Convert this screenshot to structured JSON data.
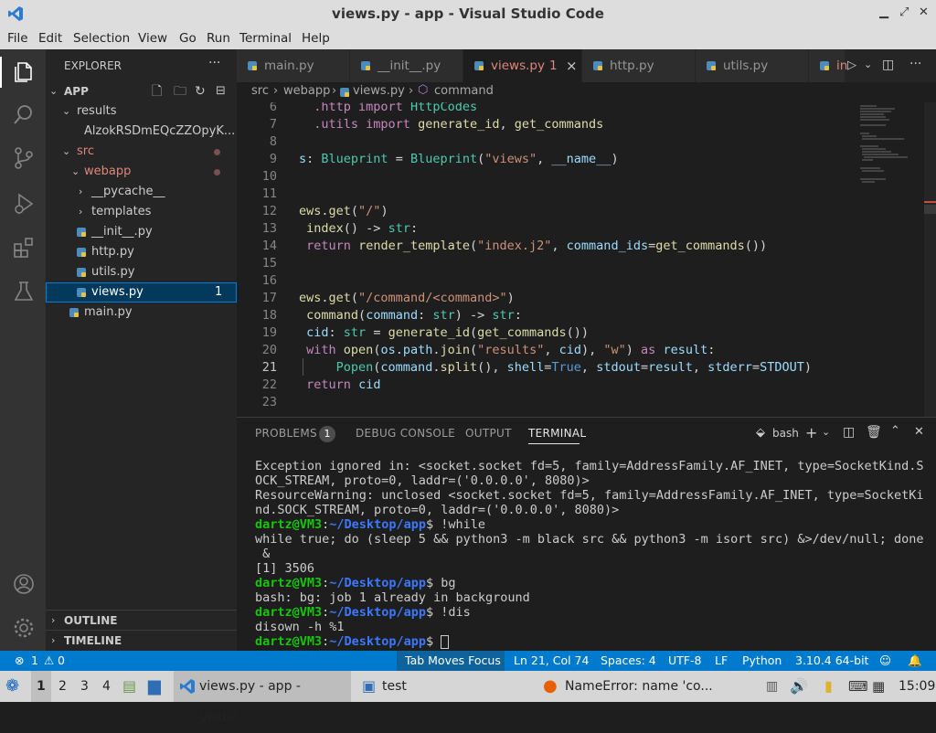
{
  "window": {
    "title": "views.py - app - Visual Studio Code"
  },
  "menu": [
    "File",
    "Edit",
    "Selection",
    "View",
    "Go",
    "Run",
    "Terminal",
    "Help"
  ],
  "explorer": {
    "header": "EXPLORER",
    "more": "···",
    "root": "APP",
    "items": [
      {
        "label": "results"
      },
      {
        "label": "AlzokRSDmEQcZZOpyK..."
      },
      {
        "label": "src"
      },
      {
        "label": "webapp"
      },
      {
        "label": "__pycache__"
      },
      {
        "label": "templates"
      },
      {
        "label": "__init__.py"
      },
      {
        "label": "http.py"
      },
      {
        "label": "utils.py"
      },
      {
        "label": "views.py",
        "badge": "1"
      },
      {
        "label": "main.py"
      }
    ],
    "outline": "OUTLINE",
    "timeline": "TIMELINE"
  },
  "tabs": [
    {
      "label": "main.py"
    },
    {
      "label": "__init__.py"
    },
    {
      "label": "views.py",
      "badge": "1",
      "close": "×"
    },
    {
      "label": "http.py"
    },
    {
      "label": "utils.py"
    },
    {
      "label": "in"
    }
  ],
  "breadcrumb": {
    "a": "src",
    "b": "webapp",
    "c": "views.py",
    "d": "command"
  },
  "code": {
    "line_numbers": [
      "6",
      "7",
      "8",
      "9",
      "10",
      "11",
      "12",
      "13",
      "14",
      "15",
      "16",
      "17",
      "18",
      "19",
      "20",
      "21",
      "22",
      "23"
    ]
  },
  "panel": {
    "tabs": [
      "PROBLEMS",
      "DEBUG CONSOLE",
      "OUTPUT",
      "TERMINAL"
    ],
    "problems_count": "1",
    "shell": "bash",
    "terminal": {
      "l1": "Exception ignored in: <socket.socket fd=5, family=AddressFamily.AF_INET, type=SocketKind.S",
      "l2": "OCK_STREAM, proto=0, laddr=('0.0.0.0', 8080)>",
      "l3": "ResourceWarning: unclosed <socket.socket fd=5, family=AddressFamily.AF_INET, type=SocketKi",
      "l4": "nd.SOCK_STREAM, proto=0, laddr=('0.0.0.0', 8080)>",
      "prompt_user": "dartz@VM3",
      "prompt_path": "~/Desktop/app",
      "c1": "!while",
      "l6": "while true; do (sleep 5 && python3 -m black src && python3 -m isort src) &>/dev/null; done",
      "l7": " &",
      "l8": "[1] 3506",
      "c2": "bg",
      "l10": "bash: bg: job 1 already in background",
      "c3": "!dis",
      "l12": "disown -h %1"
    }
  },
  "status": {
    "errors": "1",
    "warnings": "0",
    "focus": "Tab Moves Focus",
    "position": "Ln 21, Col 74",
    "spaces": "Spaces: 4",
    "encoding": "UTF-8",
    "eol": "LF",
    "language": "Python",
    "interpreter": "3.10.4 64-bit"
  },
  "taskbar": {
    "workspaces": [
      "1",
      "2",
      "3",
      "4"
    ],
    "vscode": "views.py - app - Visual...",
    "folder": "test",
    "firefox": "NameError: name 'co...",
    "clock": "15:09"
  },
  "colors": {
    "accent": "#007acc",
    "sidebar": "#252526",
    "editor": "#1e1e1e",
    "activity": "#333333"
  }
}
